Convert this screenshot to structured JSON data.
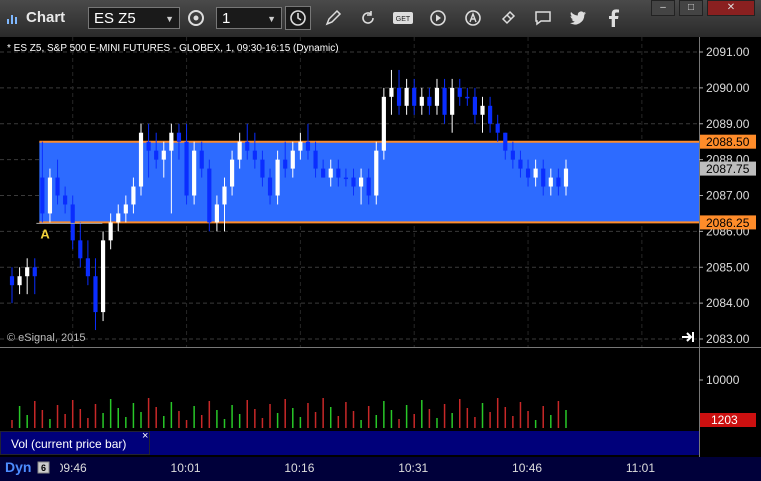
{
  "window": {
    "title": "Chart",
    "symbol": "ES Z5",
    "interval": "1",
    "controls": [
      "–",
      "□",
      "✕"
    ]
  },
  "toolbar": {
    "icons": [
      "settings-icon",
      "clock-icon",
      "pencil-icon",
      "refresh-icon",
      "get-icon",
      "play-icon",
      "alert-icon",
      "link-icon",
      "chat-icon",
      "twitter-icon",
      "facebook-icon"
    ]
  },
  "chart_header": "* ES Z5, S&P 500 E-MINI FUTURES - GLOBEX, 1, 09:30-16:15 (Dynamic)",
  "copyright": "© eSignal, 2015",
  "volume_label": "Vol (current price bar)",
  "volume_close": "×",
  "bottom_label": "Dyn",
  "colors": {
    "up": "#ffffff",
    "down": "#0a2dff",
    "band_fill": "#2d6bff",
    "band_line": "#ff8c2a",
    "vol_up": "#28c828",
    "vol_down": "#c82828"
  },
  "chart_data": {
    "type": "candlestick",
    "title": "ES Z5, S&P 500 E-MINI FUTURES - GLOBEX, 1, 09:30-16:15 (Dynamic)",
    "yticks": [
      "2083.00",
      "2084.00",
      "2085.00",
      "2086.00",
      "2087.00",
      "2088.00",
      "2089.00",
      "2090.00",
      "2091.00"
    ],
    "ylim": [
      2083.0,
      2091.3
    ],
    "xticks": [
      "09:46",
      "10:01",
      "10:16",
      "10:31",
      "10:46",
      "11:01"
    ],
    "x_start": "09:38",
    "x_end": "11:08",
    "current_price": "2087.75",
    "range_high": "2088.50",
    "range_low": "2086.25",
    "annotation": "A",
    "annotation_price": 2086.25,
    "annotation_time": "09:42",
    "candles": [
      {
        "t": "09:38",
        "o": 2084.75,
        "h": 2085.0,
        "l": 2084.0,
        "c": 2084.5,
        "dir": "down"
      },
      {
        "t": "09:39",
        "o": 2084.5,
        "h": 2085.0,
        "l": 2084.25,
        "c": 2084.75,
        "dir": "up"
      },
      {
        "t": "09:40",
        "o": 2084.75,
        "h": 2085.25,
        "l": 2084.25,
        "c": 2085.0,
        "dir": "up"
      },
      {
        "t": "09:41",
        "o": 2085.0,
        "h": 2085.25,
        "l": 2084.25,
        "c": 2084.75,
        "dir": "down"
      },
      {
        "t": "09:42",
        "o": 2087.5,
        "h": 2088.5,
        "l": 2086.25,
        "c": 2086.5,
        "dir": "down"
      },
      {
        "t": "09:43",
        "o": 2086.5,
        "h": 2087.75,
        "l": 2086.25,
        "c": 2087.5,
        "dir": "up"
      },
      {
        "t": "09:44",
        "o": 2087.5,
        "h": 2088.0,
        "l": 2086.75,
        "c": 2087.0,
        "dir": "down"
      },
      {
        "t": "09:45",
        "o": 2087.0,
        "h": 2087.25,
        "l": 2086.5,
        "c": 2086.75,
        "dir": "down"
      },
      {
        "t": "09:46",
        "o": 2086.75,
        "h": 2087.0,
        "l": 2085.5,
        "c": 2085.75,
        "dir": "down"
      },
      {
        "t": "09:47",
        "o": 2085.75,
        "h": 2086.25,
        "l": 2085.0,
        "c": 2085.25,
        "dir": "down"
      },
      {
        "t": "09:48",
        "o": 2085.25,
        "h": 2085.75,
        "l": 2084.5,
        "c": 2084.75,
        "dir": "down"
      },
      {
        "t": "09:49",
        "o": 2084.75,
        "h": 2085.25,
        "l": 2083.25,
        "c": 2083.75,
        "dir": "down"
      },
      {
        "t": "09:50",
        "o": 2083.75,
        "h": 2086.0,
        "l": 2083.5,
        "c": 2085.75,
        "dir": "up"
      },
      {
        "t": "09:51",
        "o": 2085.75,
        "h": 2086.5,
        "l": 2085.5,
        "c": 2086.25,
        "dir": "up"
      },
      {
        "t": "09:52",
        "o": 2086.25,
        "h": 2086.75,
        "l": 2086.0,
        "c": 2086.5,
        "dir": "up"
      },
      {
        "t": "09:53",
        "o": 2086.5,
        "h": 2087.0,
        "l": 2086.25,
        "c": 2086.75,
        "dir": "up"
      },
      {
        "t": "09:54",
        "o": 2086.75,
        "h": 2087.5,
        "l": 2086.5,
        "c": 2087.25,
        "dir": "up"
      },
      {
        "t": "09:55",
        "o": 2087.25,
        "h": 2089.0,
        "l": 2087.0,
        "c": 2088.75,
        "dir": "up"
      },
      {
        "t": "09:56",
        "o": 2088.5,
        "h": 2089.0,
        "l": 2087.5,
        "c": 2088.25,
        "dir": "down"
      },
      {
        "t": "09:57",
        "o": 2088.25,
        "h": 2088.75,
        "l": 2087.75,
        "c": 2088.0,
        "dir": "down"
      },
      {
        "t": "09:58",
        "o": 2088.0,
        "h": 2088.5,
        "l": 2087.5,
        "c": 2088.25,
        "dir": "up"
      },
      {
        "t": "09:59",
        "o": 2088.25,
        "h": 2089.0,
        "l": 2086.5,
        "c": 2088.75,
        "dir": "up"
      },
      {
        "t": "10:00",
        "o": 2088.75,
        "h": 2089.0,
        "l": 2088.0,
        "c": 2088.5,
        "dir": "down"
      },
      {
        "t": "10:01",
        "o": 2088.5,
        "h": 2089.0,
        "l": 2086.75,
        "c": 2087.0,
        "dir": "down"
      },
      {
        "t": "10:02",
        "o": 2087.0,
        "h": 2088.5,
        "l": 2086.75,
        "c": 2088.25,
        "dir": "up"
      },
      {
        "t": "10:03",
        "o": 2088.25,
        "h": 2088.5,
        "l": 2087.5,
        "c": 2087.75,
        "dir": "down"
      },
      {
        "t": "10:04",
        "o": 2087.75,
        "h": 2088.0,
        "l": 2086.0,
        "c": 2086.25,
        "dir": "down"
      },
      {
        "t": "10:05",
        "o": 2086.25,
        "h": 2087.0,
        "l": 2086.0,
        "c": 2086.75,
        "dir": "up"
      },
      {
        "t": "10:06",
        "o": 2086.75,
        "h": 2087.5,
        "l": 2086.0,
        "c": 2087.25,
        "dir": "up"
      },
      {
        "t": "10:07",
        "o": 2087.25,
        "h": 2088.25,
        "l": 2087.0,
        "c": 2088.0,
        "dir": "up"
      },
      {
        "t": "10:08",
        "o": 2088.0,
        "h": 2088.75,
        "l": 2087.75,
        "c": 2088.5,
        "dir": "up"
      },
      {
        "t": "10:09",
        "o": 2088.5,
        "h": 2089.0,
        "l": 2088.0,
        "c": 2088.25,
        "dir": "down"
      },
      {
        "t": "10:10",
        "o": 2088.25,
        "h": 2088.75,
        "l": 2087.75,
        "c": 2088.0,
        "dir": "down"
      },
      {
        "t": "10:11",
        "o": 2088.0,
        "h": 2088.25,
        "l": 2087.25,
        "c": 2087.5,
        "dir": "down"
      },
      {
        "t": "10:12",
        "o": 2087.5,
        "h": 2087.75,
        "l": 2086.75,
        "c": 2087.0,
        "dir": "down"
      },
      {
        "t": "10:13",
        "o": 2087.0,
        "h": 2088.25,
        "l": 2086.75,
        "c": 2088.0,
        "dir": "up"
      },
      {
        "t": "10:14",
        "o": 2088.0,
        "h": 2088.5,
        "l": 2087.5,
        "c": 2087.75,
        "dir": "down"
      },
      {
        "t": "10:15",
        "o": 2087.75,
        "h": 2088.5,
        "l": 2087.5,
        "c": 2088.25,
        "dir": "up"
      },
      {
        "t": "10:16",
        "o": 2088.25,
        "h": 2088.75,
        "l": 2088.0,
        "c": 2088.5,
        "dir": "up"
      },
      {
        "t": "10:17",
        "o": 2088.5,
        "h": 2089.0,
        "l": 2088.0,
        "c": 2088.25,
        "dir": "down"
      },
      {
        "t": "10:18",
        "o": 2088.25,
        "h": 2088.5,
        "l": 2087.5,
        "c": 2087.75,
        "dir": "down"
      },
      {
        "t": "10:19",
        "o": 2087.75,
        "h": 2088.0,
        "l": 2087.5,
        "c": 2087.5,
        "dir": "down"
      },
      {
        "t": "10:20",
        "o": 2087.5,
        "h": 2088.0,
        "l": 2087.25,
        "c": 2087.75,
        "dir": "up"
      },
      {
        "t": "10:21",
        "o": 2087.75,
        "h": 2088.0,
        "l": 2087.25,
        "c": 2087.5,
        "dir": "down"
      },
      {
        "t": "10:22",
        "o": 2087.5,
        "h": 2087.75,
        "l": 2087.25,
        "c": 2087.5,
        "dir": "down"
      },
      {
        "t": "10:23",
        "o": 2087.5,
        "h": 2087.75,
        "l": 2087.0,
        "c": 2087.25,
        "dir": "down"
      },
      {
        "t": "10:24",
        "o": 2087.25,
        "h": 2087.75,
        "l": 2086.75,
        "c": 2087.5,
        "dir": "up"
      },
      {
        "t": "10:25",
        "o": 2087.5,
        "h": 2087.75,
        "l": 2086.75,
        "c": 2087.0,
        "dir": "down"
      },
      {
        "t": "10:26",
        "o": 2087.0,
        "h": 2088.5,
        "l": 2086.75,
        "c": 2088.25,
        "dir": "up"
      },
      {
        "t": "10:27",
        "o": 2088.25,
        "h": 2090.0,
        "l": 2088.0,
        "c": 2089.75,
        "dir": "up"
      },
      {
        "t": "10:28",
        "o": 2089.75,
        "h": 2090.5,
        "l": 2089.25,
        "c": 2090.0,
        "dir": "up"
      },
      {
        "t": "10:29",
        "o": 2090.0,
        "h": 2090.5,
        "l": 2089.25,
        "c": 2089.5,
        "dir": "down"
      },
      {
        "t": "10:30",
        "o": 2089.5,
        "h": 2090.25,
        "l": 2089.25,
        "c": 2090.0,
        "dir": "up"
      },
      {
        "t": "10:31",
        "o": 2090.0,
        "h": 2090.25,
        "l": 2089.25,
        "c": 2089.5,
        "dir": "down"
      },
      {
        "t": "10:32",
        "o": 2089.5,
        "h": 2090.0,
        "l": 2089.25,
        "c": 2089.75,
        "dir": "up"
      },
      {
        "t": "10:33",
        "o": 2089.75,
        "h": 2090.0,
        "l": 2089.25,
        "c": 2089.5,
        "dir": "down"
      },
      {
        "t": "10:34",
        "o": 2089.5,
        "h": 2090.25,
        "l": 2089.25,
        "c": 2090.0,
        "dir": "up"
      },
      {
        "t": "10:35",
        "o": 2090.0,
        "h": 2090.25,
        "l": 2089.0,
        "c": 2089.25,
        "dir": "down"
      },
      {
        "t": "10:36",
        "o": 2089.25,
        "h": 2090.25,
        "l": 2088.75,
        "c": 2090.0,
        "dir": "up"
      },
      {
        "t": "10:37",
        "o": 2090.0,
        "h": 2090.25,
        "l": 2089.5,
        "c": 2089.75,
        "dir": "down"
      },
      {
        "t": "10:38",
        "o": 2089.75,
        "h": 2090.0,
        "l": 2089.5,
        "c": 2089.75,
        "dir": "down"
      },
      {
        "t": "10:39",
        "o": 2089.75,
        "h": 2090.0,
        "l": 2089.0,
        "c": 2089.25,
        "dir": "down"
      },
      {
        "t": "10:40",
        "o": 2089.25,
        "h": 2089.75,
        "l": 2088.75,
        "c": 2089.5,
        "dir": "up"
      },
      {
        "t": "10:41",
        "o": 2089.5,
        "h": 2089.75,
        "l": 2088.75,
        "c": 2089.0,
        "dir": "down"
      },
      {
        "t": "10:42",
        "o": 2089.0,
        "h": 2089.25,
        "l": 2088.5,
        "c": 2088.75,
        "dir": "down"
      },
      {
        "t": "10:43",
        "o": 2088.75,
        "h": 2088.75,
        "l": 2088.0,
        "c": 2088.25,
        "dir": "down"
      },
      {
        "t": "10:44",
        "o": 2088.25,
        "h": 2088.5,
        "l": 2087.75,
        "c": 2088.0,
        "dir": "down"
      },
      {
        "t": "10:45",
        "o": 2088.0,
        "h": 2088.25,
        "l": 2087.5,
        "c": 2087.75,
        "dir": "down"
      },
      {
        "t": "10:46",
        "o": 2087.75,
        "h": 2088.0,
        "l": 2087.25,
        "c": 2087.5,
        "dir": "down"
      },
      {
        "t": "10:47",
        "o": 2087.5,
        "h": 2088.0,
        "l": 2087.25,
        "c": 2087.75,
        "dir": "up"
      },
      {
        "t": "10:48",
        "o": 2087.75,
        "h": 2088.0,
        "l": 2087.0,
        "c": 2087.25,
        "dir": "down"
      },
      {
        "t": "10:49",
        "o": 2087.25,
        "h": 2087.75,
        "l": 2087.0,
        "c": 2087.5,
        "dir": "up"
      },
      {
        "t": "10:50",
        "o": 2087.5,
        "h": 2087.75,
        "l": 2087.0,
        "c": 2087.25,
        "dir": "down"
      },
      {
        "t": "10:51",
        "o": 2087.25,
        "h": 2088.0,
        "l": 2087.0,
        "c": 2087.75,
        "dir": "up"
      }
    ],
    "volume": {
      "label": "Vol (current price bar)",
      "yticks": [
        "10000"
      ],
      "current": "1203"
    }
  }
}
